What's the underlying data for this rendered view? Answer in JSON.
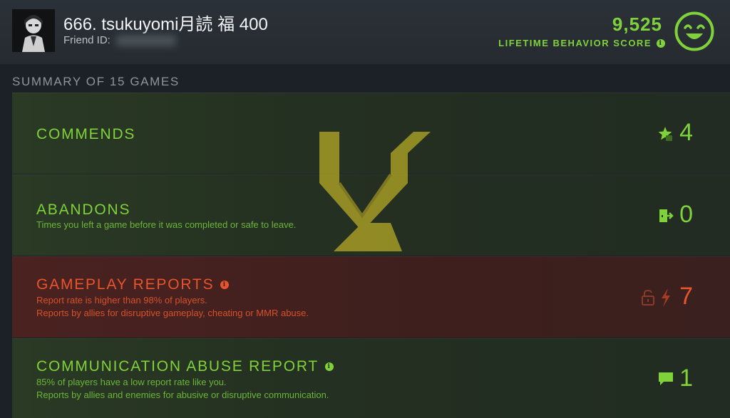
{
  "header": {
    "player_name": "666. tsukuyomi月読 福 400",
    "friend_id_label": "Friend ID:",
    "score_value": "9,525",
    "score_label": "LIFETIME BEHAVIOR SCORE",
    "score_info_icon": "info-icon",
    "mood_icon": "smiley-face-icon"
  },
  "summary": {
    "title": "SUMMARY OF 15 GAMES"
  },
  "panels": {
    "commends": {
      "title": "COMMENDS",
      "value": "4",
      "icon": "star-thumbs-up-icon"
    },
    "abandons": {
      "title": "ABANDONS",
      "description": "Times you left a game before it was completed or safe to leave.",
      "value": "0",
      "icon": "exit-door-icon"
    },
    "gameplay_reports": {
      "title": "GAMEPLAY REPORTS",
      "line1": "Report rate is higher than 98% of players.",
      "line2": "Reports by allies for disruptive gameplay, cheating or MMR abuse.",
      "value": "7",
      "icons": [
        "unlock-icon",
        "lightning-icon"
      ]
    },
    "communication_reports": {
      "title": "COMMUNICATION ABUSE REPORT",
      "line1": "85% of players have a low report rate like you.",
      "line2": "Reports by allies and enemies for abusive or disruptive communication.",
      "value": "1",
      "icon": "chat-bubble-icon"
    }
  },
  "colors": {
    "good": "#7fd23a",
    "bad": "#e8552c",
    "emblem": "#b9a62a"
  }
}
